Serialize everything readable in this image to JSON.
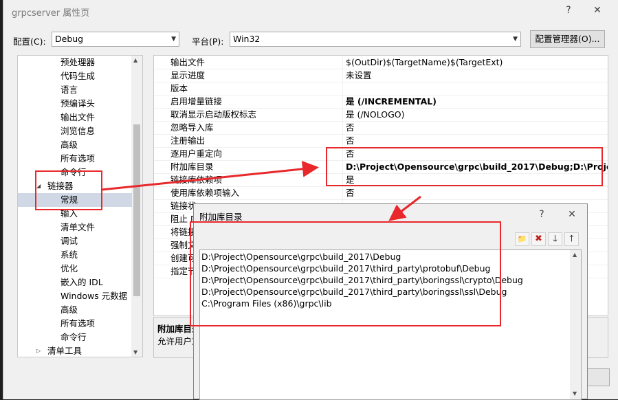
{
  "window": {
    "title": "grpcserver 属性页",
    "help": "?",
    "close": "✕"
  },
  "config": {
    "label": "配置(C):",
    "value": "Debug"
  },
  "platform": {
    "label": "平台(P):",
    "value": "Win32"
  },
  "config_manager_label": "配置管理器(O)...",
  "tree": {
    "items": [
      {
        "label": "预处理器"
      },
      {
        "label": "代码生成"
      },
      {
        "label": "语言"
      },
      {
        "label": "预编译头"
      },
      {
        "label": "输出文件"
      },
      {
        "label": "浏览信息"
      },
      {
        "label": "高级"
      },
      {
        "label": "所有选项"
      },
      {
        "label": "命令行"
      },
      {
        "label": "链接器",
        "expander": "◢"
      },
      {
        "label": "常规"
      },
      {
        "label": "输入"
      },
      {
        "label": "清单文件"
      },
      {
        "label": "调试"
      },
      {
        "label": "系统"
      },
      {
        "label": "优化"
      },
      {
        "label": "嵌入的 IDL"
      },
      {
        "label": "Windows 元数据"
      },
      {
        "label": "高级"
      },
      {
        "label": "所有选项"
      },
      {
        "label": "命令行"
      },
      {
        "label": "清单工具",
        "expander": "▷"
      }
    ],
    "scroll_up": "▲",
    "scroll_down": "▼"
  },
  "props": [
    {
      "name": "输出文件",
      "value": "$(OutDir)$(TargetName)$(TargetExt)"
    },
    {
      "name": "显示进度",
      "value": "未设置"
    },
    {
      "name": "版本",
      "value": ""
    },
    {
      "name": "启用增量链接",
      "value": "是 (/INCREMENTAL)",
      "bold": true
    },
    {
      "name": "取消显示启动版权标志",
      "value": "是 (/NOLOGO)"
    },
    {
      "name": "忽略导入库",
      "value": "否"
    },
    {
      "name": "注册输出",
      "value": "否"
    },
    {
      "name": "逐用户重定向",
      "value": "否"
    },
    {
      "name": "附加库目录",
      "value": "D:\\Project\\Opensource\\grpc\\build_2017\\Debug;D:\\Project\\Op",
      "bold": true
    },
    {
      "name": "链接库依赖项",
      "value": "是"
    },
    {
      "name": "使用库依赖项输入",
      "value": "否"
    },
    {
      "name": "链接状",
      "value": ""
    },
    {
      "name": "阻止 D",
      "value": ""
    },
    {
      "name": "将链接",
      "value": ""
    },
    {
      "name": "强制文",
      "value": ""
    },
    {
      "name": "创建可",
      "value": ""
    },
    {
      "name": "指定节",
      "value": ""
    }
  ],
  "description": {
    "title": "附加库目录",
    "text": "允许用户重"
  },
  "dialog": {
    "title": "附加库目录",
    "help": "?",
    "close": "✕",
    "toolbar": {
      "new_folder": "📁",
      "delete": "✖",
      "down": "🡓",
      "up": "🡑"
    },
    "paths": [
      "D:\\Project\\Opensource\\grpc\\build_2017\\Debug",
      "D:\\Project\\Opensource\\grpc\\build_2017\\third_party\\protobuf\\Debug",
      "D:\\Project\\Opensource\\grpc\\build_2017\\third_party\\boringssl\\crypto\\Debug",
      "D:\\Project\\Opensource\\grpc\\build_2017\\third_party\\boringssl\\ssl\\Debug",
      "C:\\Program Files (x86)\\grpc\\lib"
    ],
    "scroll_up": "▲",
    "scroll_down": "▼"
  },
  "colors": {
    "annotation_red": "#e8282b",
    "selection": "#cfd8e4"
  }
}
